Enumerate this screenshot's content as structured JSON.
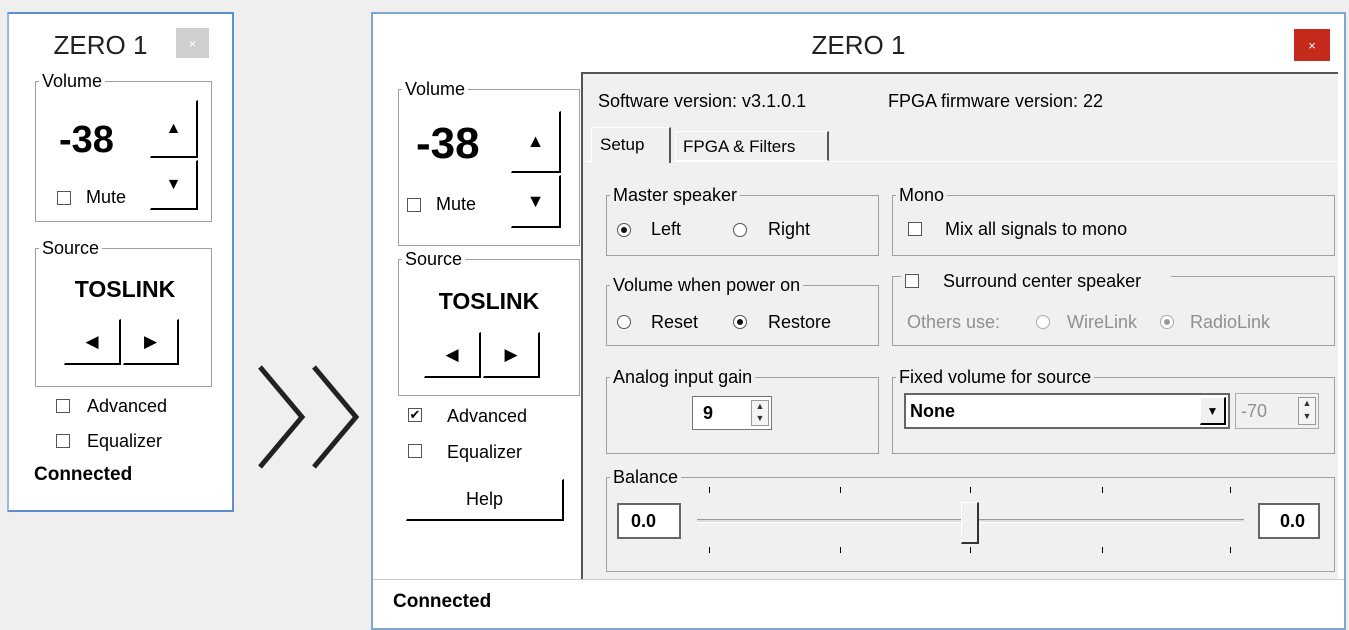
{
  "small_window": {
    "title": "ZERO 1",
    "close_glyph": "×",
    "volume": {
      "legend": "Volume",
      "value": "-38",
      "up_glyph": "▲",
      "down_glyph": "▼",
      "mute_label": "Mute",
      "mute_checked": false
    },
    "source": {
      "legend": "Source",
      "value": "TOSLINK",
      "prev_glyph": "◀",
      "next_glyph": "▶"
    },
    "advanced_label": "Advanced",
    "advanced_checked": false,
    "equalizer_label": "Equalizer",
    "equalizer_checked": false,
    "status": "Connected"
  },
  "arrow_glyph": "❯❯",
  "large_window": {
    "title": "ZERO 1",
    "close_glyph": "×",
    "close_color": "#c42b1c",
    "volume": {
      "legend": "Volume",
      "value": "-38",
      "up_glyph": "▲",
      "down_glyph": "▼",
      "mute_label": "Mute",
      "mute_checked": false
    },
    "source": {
      "legend": "Source",
      "value": "TOSLINK",
      "prev_glyph": "◀",
      "next_glyph": "▶"
    },
    "advanced_label": "Advanced",
    "advanced_checked": true,
    "check_glyph": "✔",
    "equalizer_label": "Equalizer",
    "equalizer_checked": false,
    "help_label": "Help",
    "software_version": "Software version: v3.1.0.1",
    "fpga_version": "FPGA firmware version:  22",
    "tabs": [
      {
        "label": "Setup",
        "active": true
      },
      {
        "label": "FPGA & Filters",
        "active": false
      }
    ],
    "master_speaker": {
      "legend": "Master speaker",
      "left": "Left",
      "right": "Right",
      "selected": "Left"
    },
    "mono": {
      "legend": "Mono",
      "option": "Mix all signals to mono",
      "checked": false
    },
    "volume_power_on": {
      "legend": "Volume when power on",
      "reset": "Reset",
      "restore": "Restore",
      "selected": "Restore"
    },
    "surround": {
      "legend": "Surround center speaker",
      "checked": false,
      "others_use": "Others use:",
      "wirelink": "WireLink",
      "radiolink": "RadioLink",
      "selected": "RadioLink"
    },
    "analog_gain": {
      "legend": "Analog input gain",
      "value": "9",
      "up_glyph": "▲",
      "down_glyph": "▼"
    },
    "fixed_volume": {
      "legend": "Fixed volume for source",
      "selected": "None",
      "dropdown_glyph": "▼",
      "level": "-70"
    },
    "balance": {
      "legend": "Balance",
      "left_value": "0.0",
      "right_value": "0.0",
      "position_fraction": 0.5
    },
    "status": "Connected"
  }
}
